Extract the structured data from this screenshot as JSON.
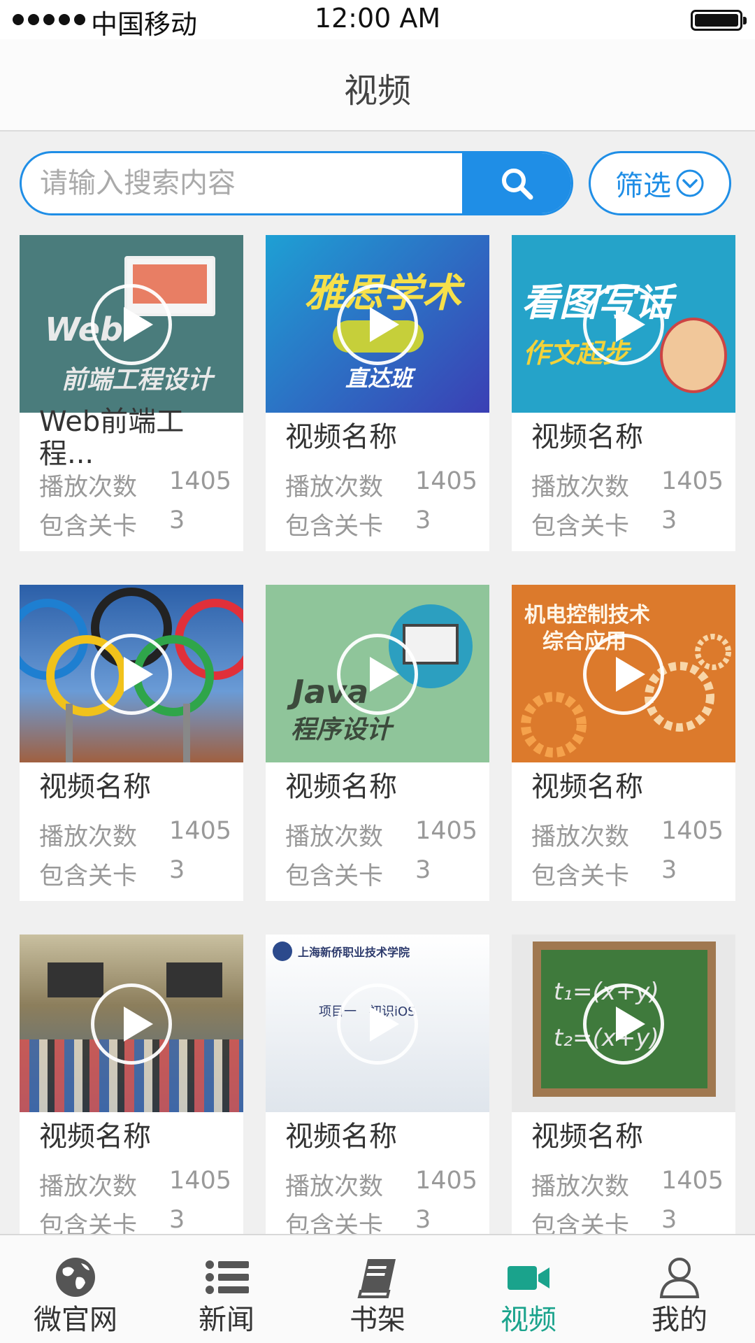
{
  "status_bar": {
    "carrier": "中国移动",
    "time": "12:00 AM"
  },
  "nav": {
    "title": "视频"
  },
  "search": {
    "placeholder": "请输入搜索内容",
    "filter_label": "筛选"
  },
  "stat_labels": {
    "plays": "播放次数",
    "levels": "包含关卡"
  },
  "videos": [
    {
      "title": "Web前端工程...",
      "plays": "1405",
      "levels": "3",
      "thumb_text": [
        "Web",
        "前端工程设计"
      ],
      "thumb_color": "#4a7c7c"
    },
    {
      "title": "视频名称",
      "plays": "1405",
      "levels": "3",
      "thumb_text": [
        "雅思学术",
        "直达班"
      ],
      "thumb_color": "#2c62c2"
    },
    {
      "title": "视频名称",
      "plays": "1405",
      "levels": "3",
      "thumb_text": [
        "看图写话",
        "作文起步"
      ],
      "thumb_color": "#25a3c9"
    },
    {
      "title": "视频名称",
      "plays": "1405",
      "levels": "3",
      "thumb_text": [],
      "thumb_color": "#3d73b8"
    },
    {
      "title": "视频名称",
      "plays": "1405",
      "levels": "3",
      "thumb_text": [
        "Java",
        "程序设计"
      ],
      "thumb_color": "#8fc59a"
    },
    {
      "title": "视频名称",
      "plays": "1405",
      "levels": "3",
      "thumb_text": [
        "机电控制技术",
        "综合应用"
      ],
      "thumb_color": "#dc7a2c"
    },
    {
      "title": "视频名称",
      "plays": "1405",
      "levels": "3",
      "thumb_text": [],
      "thumb_color": "#8a8060"
    },
    {
      "title": "视频名称",
      "plays": "1405",
      "levels": "3",
      "thumb_text": [
        "上海新侨职业技术学院",
        "项目一　初识iOS"
      ],
      "thumb_color": "#dfe5ec"
    },
    {
      "title": "视频名称",
      "plays": "1405",
      "levels": "3",
      "thumb_text": [
        "t₁=(x+y)",
        "t₂=(x+y)"
      ],
      "thumb_color": "#3f7a3c"
    }
  ],
  "tabs": [
    {
      "label": "微官网",
      "icon": "globe-icon"
    },
    {
      "label": "新闻",
      "icon": "list-icon"
    },
    {
      "label": "书架",
      "icon": "book-icon"
    },
    {
      "label": "视频",
      "icon": "video-camera-icon"
    },
    {
      "label": "我的",
      "icon": "user-icon"
    }
  ],
  "colors": {
    "accent": "#1f8ee6",
    "tab_active": "#1aa38c"
  }
}
